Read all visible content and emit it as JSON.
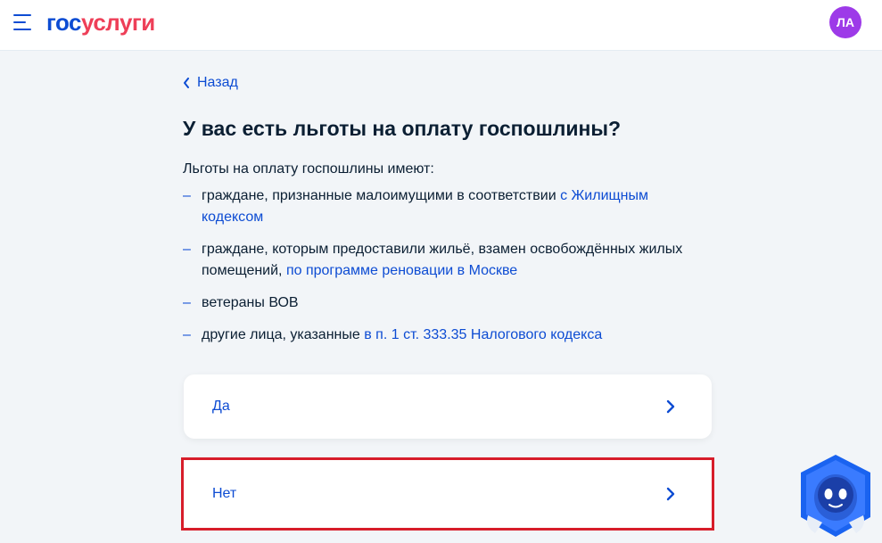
{
  "header": {
    "logo_part1": "гос",
    "logo_part2": "услуги",
    "avatar_initials": "ЛА"
  },
  "nav": {
    "back_label": "Назад"
  },
  "main": {
    "title": "У вас есть льготы на оплату госпошлины?",
    "intro": "Льготы на оплату госпошлины имеют:",
    "items": [
      {
        "text": "граждане, признанные малоимущими в соответствии ",
        "link": "с Жилищным кодексом"
      },
      {
        "text": "граждане, которым предоставили жильё, взамен освобождённых жилых помещений, ",
        "link": "по программе реновации в Москве"
      },
      {
        "text": "ветераны ВОВ",
        "link": ""
      },
      {
        "text": "другие лица, указанные ",
        "link": "в п. 1 ст. 333.35 Налогового кодекса"
      }
    ],
    "options": [
      {
        "label": "Да"
      },
      {
        "label": "Нет"
      }
    ]
  },
  "colors": {
    "brand_blue": "#0d4cd3",
    "brand_red": "#ee3f58",
    "highlight": "#d71d2a",
    "avatar": "#9d3ae8"
  },
  "icons": {
    "menu": "menu-icon",
    "back": "chevron-left-icon",
    "option_arrow": "chevron-right-icon",
    "assistant": "robot-assistant-icon"
  }
}
